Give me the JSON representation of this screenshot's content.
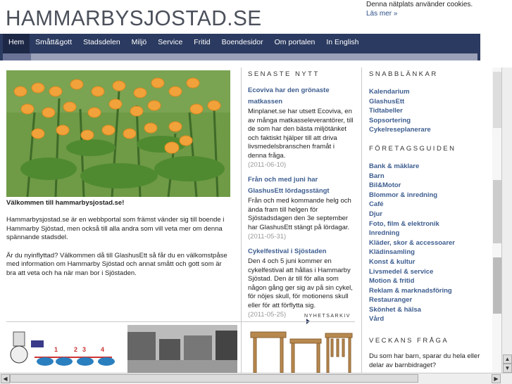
{
  "site": {
    "title": "HAMMARBYSJOSTAD.SE"
  },
  "cookie": {
    "text": "Denna nätplats använder cookies.",
    "link": "Läs mer »"
  },
  "nav": [
    "Hem",
    "Smått&gott",
    "Stadsdelen",
    "Miljö",
    "Service",
    "Fritid",
    "Boendesidor",
    "Om portalen",
    "In English"
  ],
  "intro": {
    "caption": "Välkommen till hammarbysjostad.se!",
    "p1": "Hammarbysjostad.se är en webbportal som främst vänder sig till boende i Hammarby Sjöstad, men också till alla andra som vill veta mer om denna spännande stadsdel.",
    "p2": "Är du nyinflyttad? Välkommen då till GlashusEtt så får du en välkomstpåse med information om Hammarby Sjöstad och annat smått och gott som är bra att veta och ha när man bor i Sjöstaden."
  },
  "news": {
    "heading": "SENASTE NYTT",
    "items": [
      {
        "title": "Ecoviva har den grönaste matkassen",
        "body": "Minplanet.se har utsett Ecoviva, en av många matkasseleverantörer, till de som har den bästa miljötänket och faktiskt hjälper till att driva livsmedelsbranschen framåt i denna fråga.",
        "date": "(2011-06-10)"
      },
      {
        "title": "Från och med juni har GlashusEtt lördagsstängt",
        "body": "Från och med kommande helg och ända fram till helgen för Sjöstadsdagen den 3e september har GlashusEtt stängt på lördagar.",
        "date": "(2011-05-31)"
      },
      {
        "title": "Cykelfestival i Sjöstaden",
        "body": "Den 4 och 5 juni kommer en cykelfestival att hållas i Hammarby Sjöstad. Den är till för alla som någon gång ger sig av på sin cykel, för nöjes skull, för motionens skull eller för att förflytta sig.",
        "date": "(2011-05-25)"
      }
    ],
    "archive": "NYHETSARKIV"
  },
  "quicklinks": {
    "heading": "SNABBLÄNKAR",
    "items": [
      "Kalendarium",
      "GlashusEtt",
      "Tidtabeller",
      "Sopsortering",
      "Cykelreseplanerare"
    ]
  },
  "guide": {
    "heading": "FÖRETAGSGUIDEN",
    "items": [
      "Bank & mäklare",
      "Barn",
      "Bil&Motor",
      "Blommor & inredning",
      "Café",
      "Djur",
      "Foto, film & elektronik",
      "Inredning",
      "Kläder, skor & accessoarer",
      "Klädinsamling",
      "Konst & kultur",
      "Livsmedel & service",
      "Motion & fritid",
      "Reklam & marknadsföring",
      "Restauranger",
      "Skönhet & hälsa",
      "Vård"
    ]
  },
  "poll": {
    "heading": "VECKANS FRÅGA",
    "question": "Du som har barn, sparar du hela eller delar av barnbidraget?"
  },
  "thumb_labels": [
    "1",
    "2",
    "3",
    "4"
  ],
  "colors": {
    "nav": "#2b3a60",
    "link": "#3d5d8f",
    "orange": "#f2a23a"
  }
}
